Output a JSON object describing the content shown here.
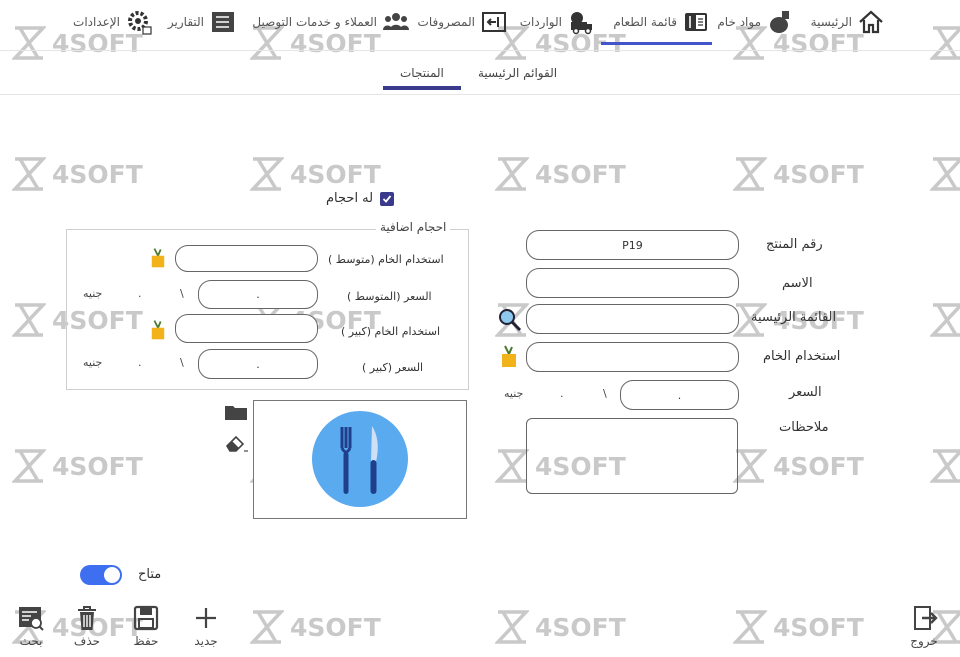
{
  "nav": {
    "home": "الرئيسية",
    "raw_materials": "مواد خام",
    "menu": "قائمة الطعام",
    "imports": "الواردات",
    "expenses": "المصروفات",
    "customers": "العملاء و خدمات التوصيل",
    "reports": "التقارير",
    "settings": "الإعدادات"
  },
  "subtabs": {
    "main_lists": "القوائم الرئيسية",
    "products": "المنتجات"
  },
  "form": {
    "product_number_label": "رقم المنتج",
    "product_number_value": "P19",
    "name_label": "الاسم",
    "main_list_label": "القائمة الرئيسية",
    "raw_usage_label": "استخدام الخام",
    "price_label": "السعر",
    "price_value": ".",
    "price_separator": "\\",
    "price_zero": ".",
    "price_currency": "جنيه",
    "notes_label": "ملاحظات",
    "has_sizes_label": "له احجام"
  },
  "extra_sizes": {
    "title": "احجام اضافية",
    "medium_raw_label": "استخدام الخام (متوسط )",
    "medium_price_label": "السعر (المتوسط )",
    "medium_price_value": ".",
    "large_raw_label": "استخدام الخام (كبير )",
    "large_price_label": "السعر (كبير )",
    "large_price_value": ".",
    "separator": "\\",
    "zero": ".",
    "currency": "جنيه"
  },
  "available_label": "متاح",
  "toolbar": {
    "exit": "خروج",
    "new": "جديد",
    "save": "حفظ",
    "delete": "حذف",
    "search": "بحث"
  },
  "watermark": "4SOFT",
  "colors": {
    "accent": "#4455cc",
    "tab_underline": "#3a3a8c",
    "toggle": "#3d6ff0",
    "plate": "#5aaaf0",
    "cutlery": "#1f3f8a"
  }
}
